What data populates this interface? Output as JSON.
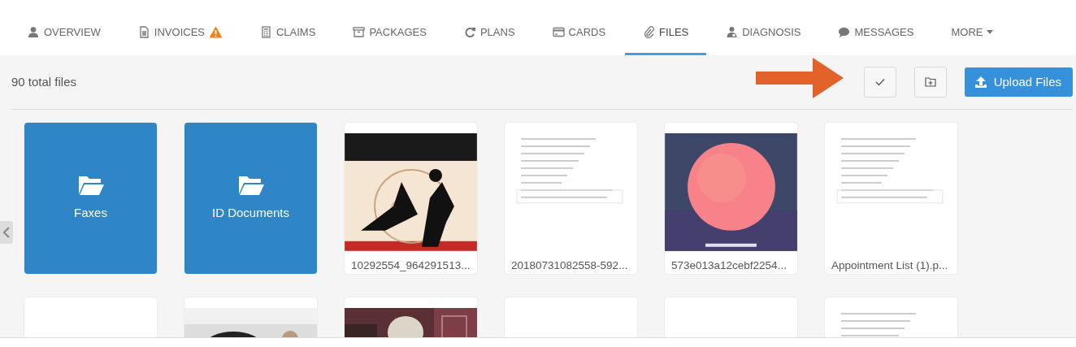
{
  "tabs": [
    {
      "label": "OVERVIEW",
      "selected": false,
      "warning": false,
      "dropdown": false
    },
    {
      "label": "INVOICES",
      "selected": false,
      "warning": true,
      "dropdown": false
    },
    {
      "label": "CLAIMS",
      "selected": false,
      "warning": false,
      "dropdown": false
    },
    {
      "label": "PACKAGES",
      "selected": false,
      "warning": false,
      "dropdown": false
    },
    {
      "label": "PLANS",
      "selected": false,
      "warning": false,
      "dropdown": false
    },
    {
      "label": "CARDS",
      "selected": false,
      "warning": false,
      "dropdown": false
    },
    {
      "label": "FILES",
      "selected": true,
      "warning": false,
      "dropdown": false
    },
    {
      "label": "DIAGNOSIS",
      "selected": false,
      "warning": false,
      "dropdown": false
    },
    {
      "label": "MESSAGES",
      "selected": false,
      "warning": false,
      "dropdown": false
    },
    {
      "label": "MORE",
      "selected": false,
      "warning": false,
      "dropdown": true
    }
  ],
  "toolbar": {
    "count": "90 total files",
    "buttons": [
      {
        "kind": "check"
      },
      {
        "kind": "new-folder"
      },
      {
        "kind": "upload",
        "label": "Upload Files"
      }
    ]
  },
  "files": [
    {
      "kind": "folder",
      "name": "Faxes"
    },
    {
      "kind": "folder",
      "name": "ID Documents"
    },
    {
      "kind": "picture",
      "name": "10292554_964291513..."
    },
    {
      "kind": "document",
      "name": "20180731082558-592..."
    },
    {
      "kind": "picture",
      "name": "573e013a12cebf2254..."
    },
    {
      "kind": "document",
      "name": "Appointment List (1).p..."
    },
    {
      "kind": "blank"
    },
    {
      "kind": "picture"
    },
    {
      "kind": "picture"
    },
    {
      "kind": "blank"
    },
    {
      "kind": "blank"
    },
    {
      "kind": "document"
    }
  ]
}
